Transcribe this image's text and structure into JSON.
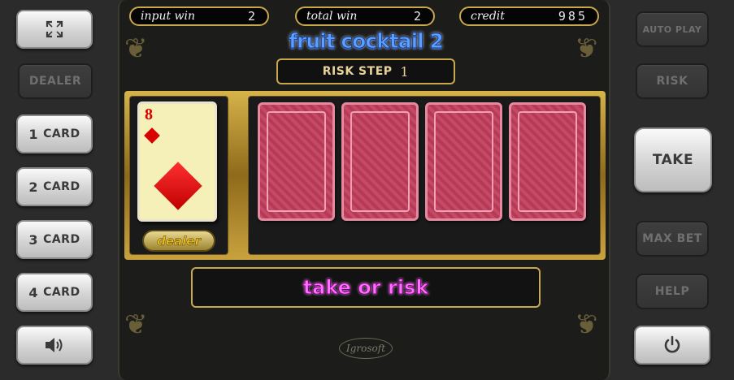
{
  "left_buttons": [
    {
      "id": "fullscreen",
      "label": "",
      "icon": "fullscreen-icon",
      "enabled": true
    },
    {
      "id": "dealer",
      "label": "DEALER",
      "enabled": false
    },
    {
      "id": "card1",
      "num": "1",
      "label": "CARD",
      "enabled": true
    },
    {
      "id": "card2",
      "num": "2",
      "label": "CARD",
      "enabled": true
    },
    {
      "id": "card3",
      "num": "3",
      "label": "CARD",
      "enabled": true
    },
    {
      "id": "card4",
      "num": "4",
      "label": "CARD",
      "enabled": true
    },
    {
      "id": "sound",
      "label": "",
      "icon": "speaker-icon",
      "enabled": true
    }
  ],
  "right_buttons": [
    {
      "id": "autoplay",
      "label": "AUTO PLAY",
      "enabled": false
    },
    {
      "id": "risk",
      "label": "RISK",
      "enabled": false
    },
    {
      "id": "take",
      "label": "TAKE",
      "enabled": true
    },
    {
      "id": "maxbet",
      "label": "MAX BET",
      "enabled": false
    },
    {
      "id": "help",
      "label": "HELP",
      "enabled": false
    },
    {
      "id": "power",
      "label": "",
      "icon": "power-icon",
      "enabled": true
    }
  ],
  "stats": {
    "input_win_label": "input win",
    "input_win_value": "2",
    "total_win_label": "total win",
    "total_win_value": "2",
    "credit_label": "credit",
    "credit_value": "985"
  },
  "game": {
    "title": "fruit cocktail 2",
    "risk_step_label": "RISK STEP",
    "risk_step_value": "1",
    "message": "take or risk",
    "dealer_label": "dealer",
    "logo": "Igrosoft"
  },
  "dealer_card": {
    "rank": "8",
    "suit": "diamonds",
    "color": "#d80000"
  },
  "player_cards": [
    {
      "state": "face-down"
    },
    {
      "state": "face-down"
    },
    {
      "state": "face-down"
    },
    {
      "state": "face-down"
    }
  ],
  "colors": {
    "gold": "#c8a84a",
    "message": "#ff70ff",
    "title": "#5aa0ff",
    "card_back": "#c64a66"
  }
}
